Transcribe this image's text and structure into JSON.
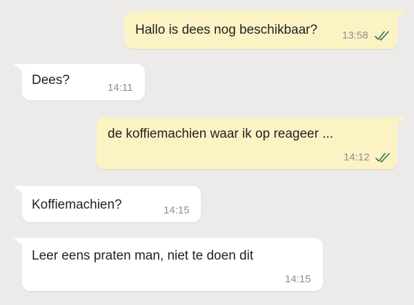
{
  "colors": {
    "background": "#ecebe9",
    "outgoing_bubble": "#fcf3c5",
    "incoming_bubble": "#ffffff",
    "read_ticks": "#2f6f56",
    "timestamp": "#8e8e8e",
    "text": "#222222"
  },
  "messages": [
    {
      "direction": "outgoing",
      "text": "Hallo is dees nog beschikbaar?",
      "time": "13:58",
      "status_icon": "double-check-read-icon"
    },
    {
      "direction": "incoming",
      "text": "Dees?",
      "time": "14:11"
    },
    {
      "direction": "outgoing",
      "text": "de koffiemachien waar ik op reageer ...",
      "time": "14:12",
      "status_icon": "double-check-read-icon"
    },
    {
      "direction": "incoming",
      "text": "Koffiemachien?",
      "time": "14:15"
    },
    {
      "direction": "incoming",
      "text": "Leer eens praten man, niet te doen dit",
      "time": "14:15"
    }
  ]
}
